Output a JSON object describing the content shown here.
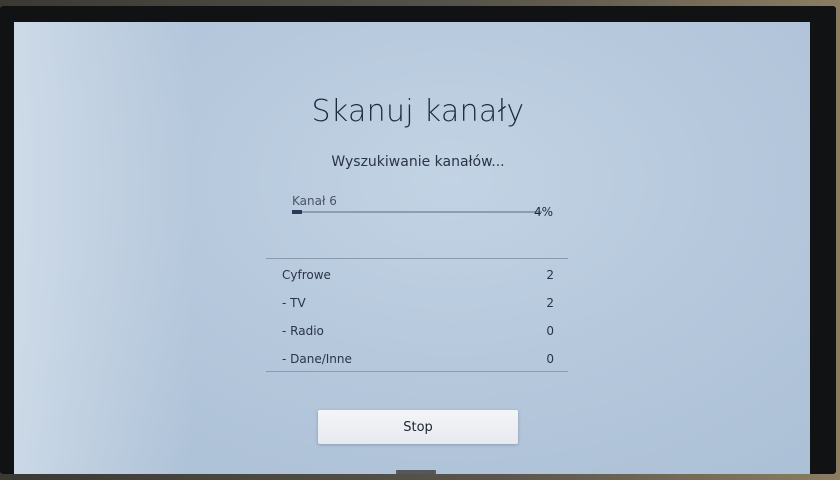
{
  "screen": {
    "title": "Skanuj kanały",
    "subtitle": "Wyszukiwanie kanałów...",
    "progress": {
      "channel_label": "Kanał  6",
      "percent": 4,
      "percent_label": "4%"
    },
    "results": [
      {
        "label": "Cyfrowe",
        "value": "2"
      },
      {
        "label": "- TV",
        "value": "2"
      },
      {
        "label": "- Radio",
        "value": "0"
      },
      {
        "label": "- Dane/Inne",
        "value": "0"
      }
    ],
    "stop_label": "Stop"
  },
  "colors": {
    "screen_background": "#b6c8dc",
    "text": "#1f2a3c",
    "button_background": "#eef1f5"
  }
}
